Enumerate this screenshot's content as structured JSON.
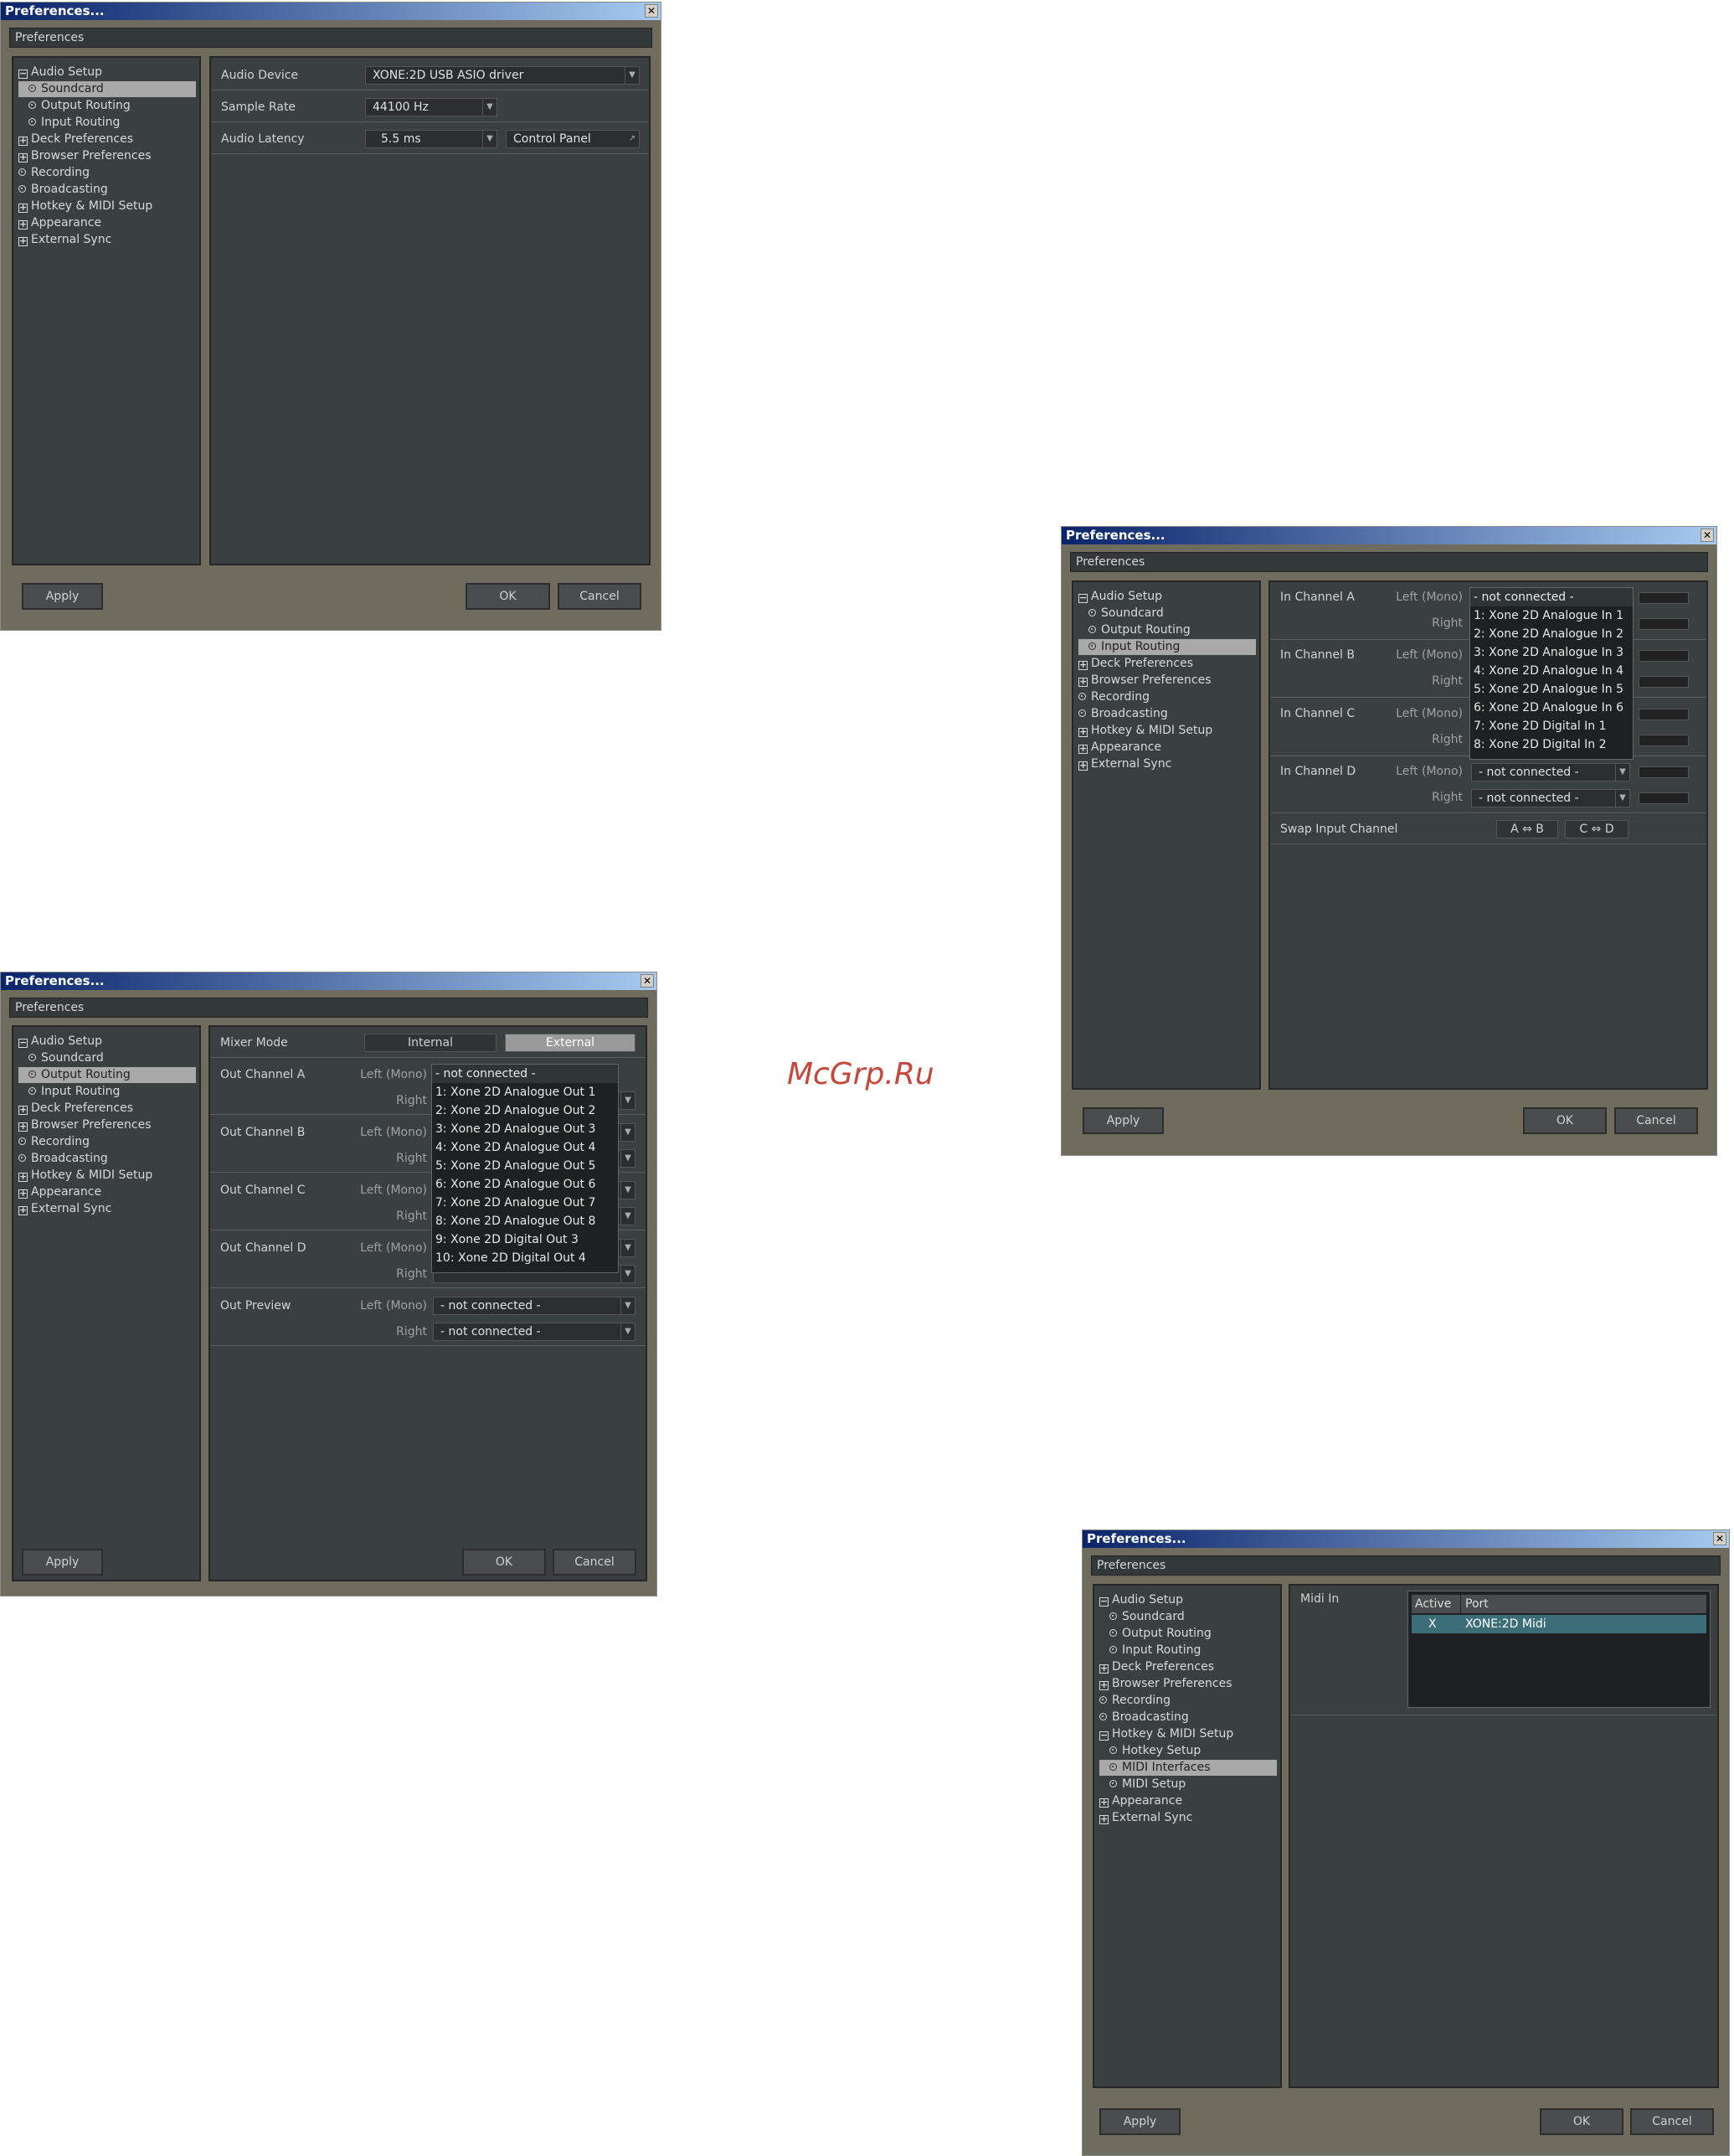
{
  "watermark": "McGrp.Ru",
  "window_title": "Preferences...",
  "header": "Preferences",
  "close_glyph": "✕",
  "buttons": {
    "apply": "Apply",
    "ok": "OK",
    "cancel": "Cancel"
  },
  "tree": {
    "audio_setup": "Audio Setup",
    "soundcard": "Soundcard",
    "output_routing": "Output Routing",
    "input_routing": "Input Routing",
    "deck_preferences": "Deck Preferences",
    "browser_preferences": "Browser Preferences",
    "recording": "Recording",
    "broadcasting": "Broadcasting",
    "hotkey_midi_setup": "Hotkey & MIDI Setup",
    "hotkey_setup": "Hotkey Setup",
    "midi_interfaces": "MIDI Interfaces",
    "midi_setup": "MIDI Setup",
    "appearance": "Appearance",
    "external_sync": "External Sync"
  },
  "soundcard_panel": {
    "audio_device_label": "Audio Device",
    "audio_device_value": "XONE:2D USB ASIO driver",
    "sample_rate_label": "Sample Rate",
    "sample_rate_value": "44100 Hz",
    "audio_latency_label": "Audio Latency",
    "audio_latency_value": "5.5 ms",
    "control_panel": "Control Panel"
  },
  "input_panel": {
    "channels": [
      {
        "label": "In Channel A",
        "left": "Left (Mono)",
        "right": "Right",
        "left_value": "- not connected -",
        "right_value": ""
      },
      {
        "label": "In Channel B",
        "left": "Left (Mono)",
        "right": "Right",
        "left_value": "",
        "right_value": ""
      },
      {
        "label": "In Channel C",
        "left": "Left (Mono)",
        "right": "Right",
        "left_value": "",
        "right_value": ""
      },
      {
        "label": "In Channel D",
        "left": "Left (Mono)",
        "right": "Right",
        "left_value": "- not connected -",
        "right_value": "- not connected -"
      }
    ],
    "popup_options": [
      "- not connected -",
      "1: Xone 2D Analogue In 1",
      "2: Xone 2D Analogue In 2",
      "3: Xone 2D Analogue In 3",
      "4: Xone 2D Analogue In 4",
      "5: Xone 2D Analogue In 5",
      "6: Xone 2D Analogue In 6",
      "7: Xone 2D Digital In 1",
      "8: Xone 2D Digital In 2"
    ],
    "swap_label": "Swap Input Channel",
    "swap_ab": "A ⇔ B",
    "swap_cd": "C ⇔ D"
  },
  "output_panel": {
    "mixer_mode_label": "Mixer Mode",
    "mode_internal": "Internal",
    "mode_external": "External",
    "channels": [
      {
        "label": "Out Channel A",
        "left": "Left (Mono)",
        "right": "Right"
      },
      {
        "label": "Out Channel B",
        "left": "Left (Mono)",
        "right": "Right"
      },
      {
        "label": "Out Channel C",
        "left": "Left (Mono)",
        "right": "Right"
      },
      {
        "label": "Out Channel D",
        "left": "Left (Mono)",
        "right": "Right"
      },
      {
        "label": "Out Preview",
        "left": "Left (Mono)",
        "right": "Right"
      }
    ],
    "preview_left_value": "- not connected -",
    "preview_right_value": "- not connected -",
    "popup_options": [
      "- not connected -",
      "1: Xone 2D Analogue Out 1",
      "2: Xone 2D Analogue Out 2",
      "3: Xone 2D Analogue Out 3",
      "4: Xone 2D Analogue Out 4",
      "5: Xone 2D Analogue Out 5",
      "6: Xone 2D Analogue Out 6",
      "7: Xone 2D Analogue Out 7",
      "8: Xone 2D Analogue Out 8",
      "9: Xone 2D Digital Out 3",
      "10: Xone 2D Digital Out 4"
    ]
  },
  "midi_panel": {
    "midi_in_label": "Midi In",
    "col_active": "Active",
    "col_port": "Port",
    "row_active": "X",
    "row_port": "XONE:2D Midi"
  }
}
